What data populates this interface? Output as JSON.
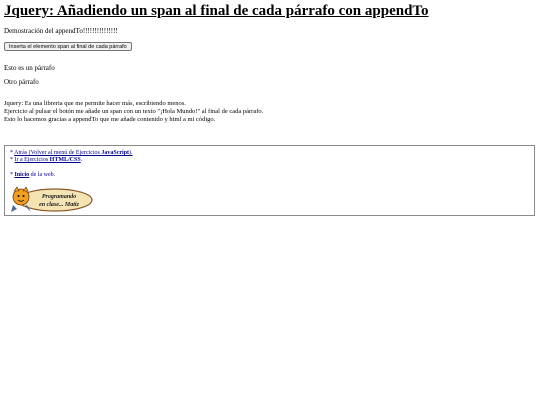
{
  "page": {
    "title": "Jquery: Añadiendo un span al final de cada párrafo con appendTo",
    "intro": "Demostración del appendTo!!!!!!!!!!!!!!!"
  },
  "button": {
    "label": "Inserta el elemento span al final de cada párrafo"
  },
  "paragraphs": [
    "Esto es un párrafo",
    "Otro párrafo"
  ],
  "explanation": [
    "Jquery: Es una libreria que me permite hacer más, escribiendo menos.",
    "Ejercicio al pulsar el botón me añade un span con un texto \"¡Hola Mundo!\" al final de cada párrafo.",
    "Esto lo hacemos gracias a appendTo que me añade contenido y html a mi código."
  ],
  "nav": {
    "bullet": "*",
    "back_prefix": "Atrás (Volver al menú de Ejercicios ",
    "back_strong": "JavaScript",
    "back_suffix": ").",
    "exercises_prefix": "Ir a Ejercicios ",
    "exercises_strong": "HTML/CSS",
    "exercises_suffix": ".",
    "home_strong": "Inicio",
    "home_suffix": " de la web."
  },
  "badge": {
    "line1": "Programando",
    "line2": "en clase... Matiz"
  },
  "colors": {
    "link": "#00008b",
    "badge_fill": "#f4e4b4",
    "badge_border": "#8a5a2a",
    "mascot": "#f0a020"
  }
}
